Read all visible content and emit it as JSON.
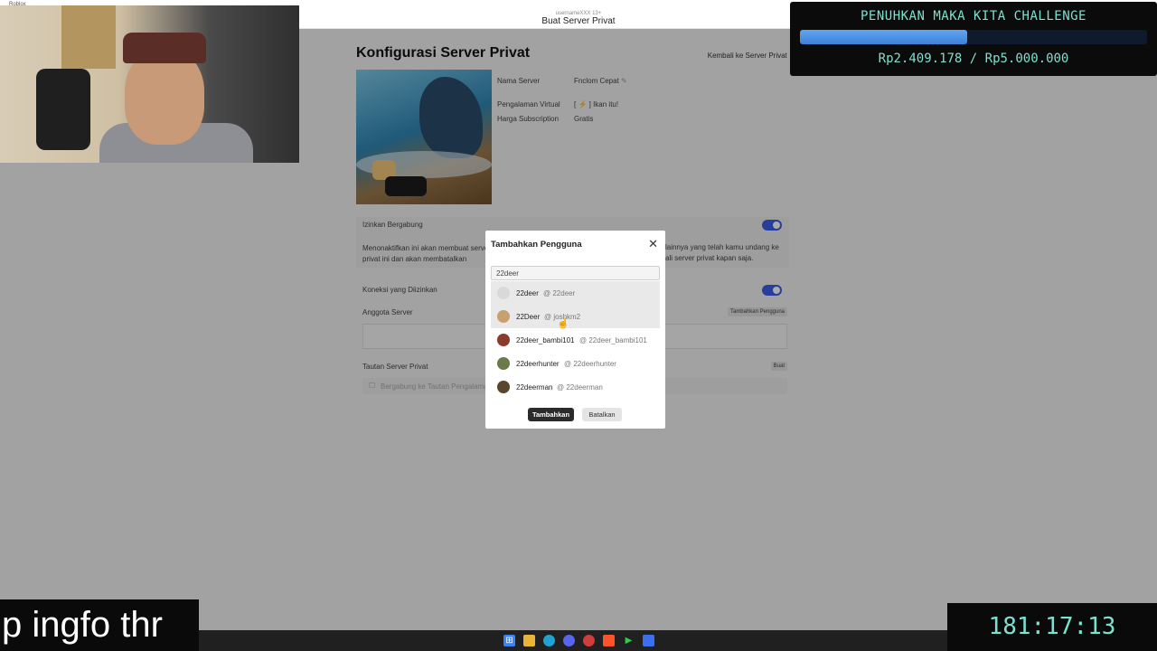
{
  "window": {
    "app_name": "Roblox",
    "user_small": "usernameXXX 13+",
    "title": "Buat Server Privat"
  },
  "page": {
    "title": "Konfigurasi Server Privat",
    "back_link": "Kembali ke Server Privat",
    "server_name_label": "Nama Server",
    "server_name_value": "Fnclom Cepat",
    "experience_label": "Pengalaman Virtual",
    "experience_value": "[ ⚡ ] Ikan itu!",
    "subscription_label": "Harga Subscription",
    "subscription_value": "Gratis",
    "allow_join_label": "Izinkan Bergabung",
    "allow_join_desc_left": "Menonaktifkan ini akan membuat server privat ini dan akan membatalkan",
    "allow_join_desc_right": "lainnya yang telah kamu undang ke",
    "allow_join_desc_right2": "ali server privat kapan saja.",
    "connections_label": "Koneksi yang Diizinkan",
    "members_label": "Anggota Server",
    "add_user_small": "Tambahkan Pengguna",
    "link_label": "Tautan Server Privat",
    "link_create": "Buat",
    "link_join_text": "Bergabung ke Tautan Pengalaman"
  },
  "modal": {
    "title": "Tambahkan Pengguna",
    "search_value": "22deer",
    "results": [
      {
        "name": "22deer",
        "handle": "@ 22deer",
        "avatar_color": "#d9d9d9"
      },
      {
        "name": "22Deer",
        "handle": "@ joshkm2",
        "avatar_color": "#c8a070"
      },
      {
        "name": "22deer_bambi101",
        "handle": "@ 22deer_bambi101",
        "avatar_color": "#8b3a2e"
      },
      {
        "name": "22deerhunter",
        "handle": "@ 22deerhunter",
        "avatar_color": "#6b7a4a"
      },
      {
        "name": "22deerman",
        "handle": "@ 22deerman",
        "avatar_color": "#5a4630"
      }
    ],
    "add_button": "Tambahkan",
    "cancel_button": "Batalkan"
  },
  "overlay": {
    "donation_title": "PENUHKAN MAKA KITA CHALLENGE",
    "donation_amount": "Rp2.409.178 / Rp5.000.000",
    "donation_progress": 0.482,
    "caption": "p ingfo thr",
    "timer": "181:17:13"
  },
  "colors": {
    "accent": "#3b5ee8",
    "overlay_text": "#7ee0cf",
    "progress": "#4f92e6"
  }
}
